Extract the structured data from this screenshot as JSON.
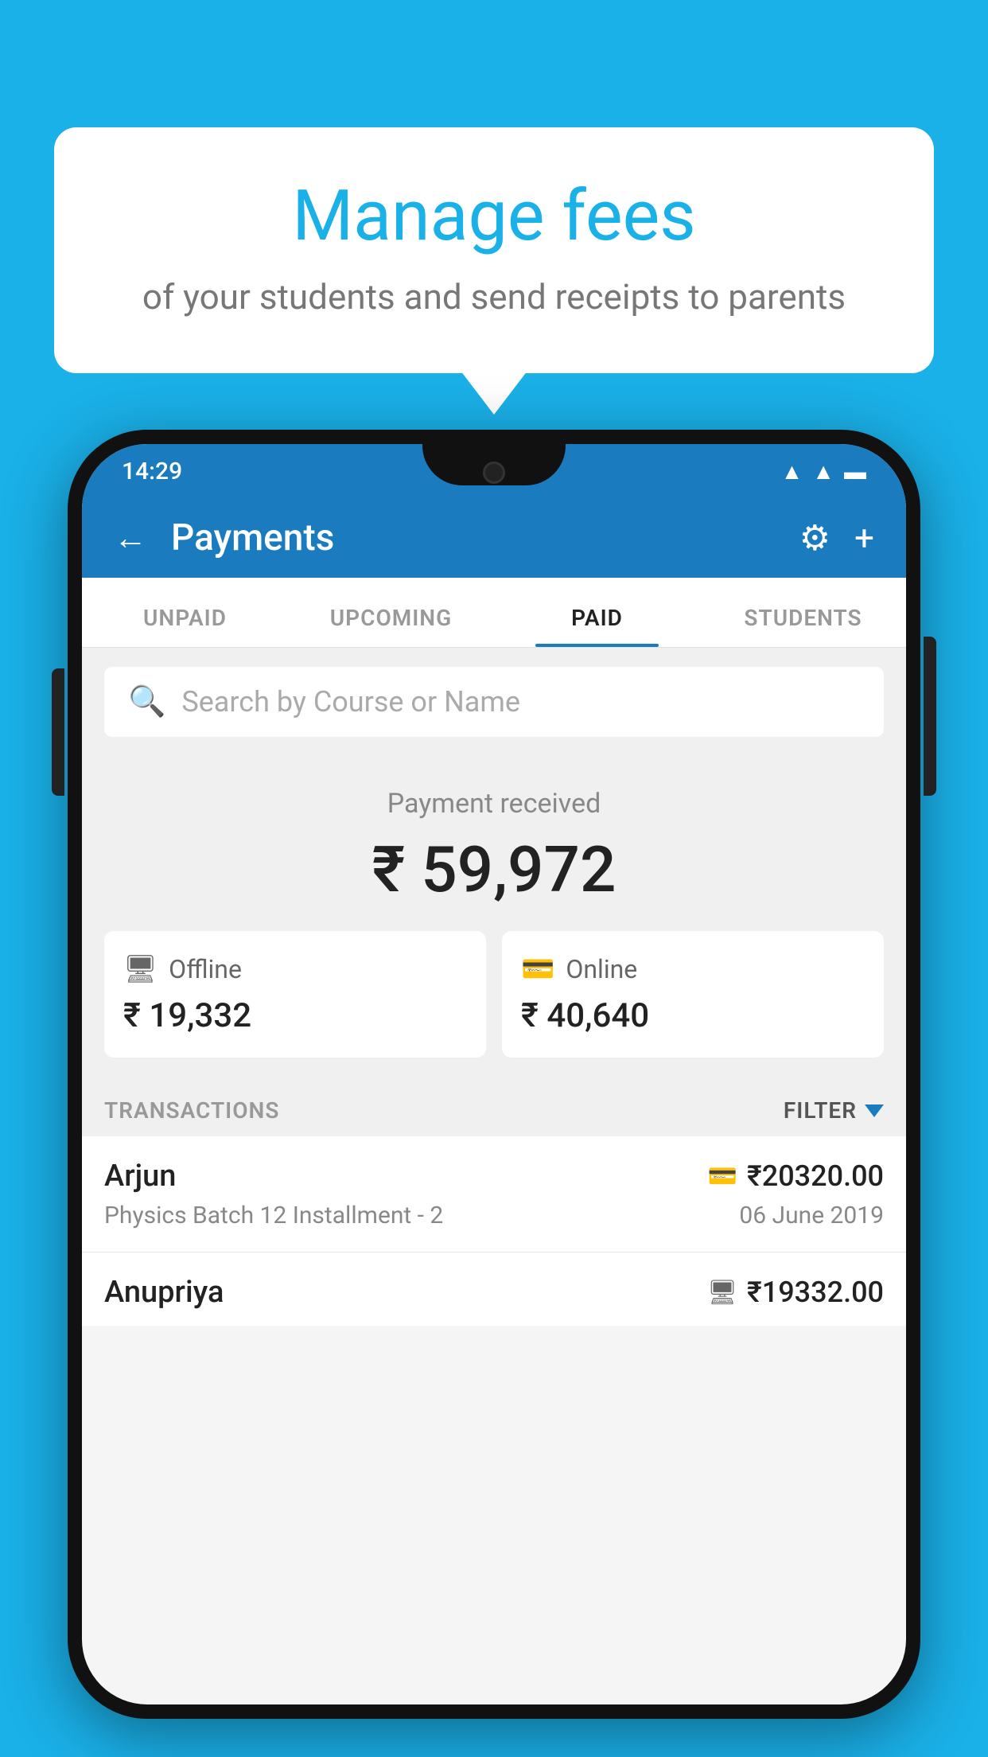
{
  "background_color": "#1ab0e8",
  "bubble": {
    "title": "Manage fees",
    "subtitle": "of your students and send receipts to parents"
  },
  "status_bar": {
    "time": "14:29",
    "wifi_icon": "▲",
    "signal_icon": "▲",
    "battery_icon": "▪"
  },
  "header": {
    "title": "Payments",
    "back_label": "←",
    "plus_label": "+"
  },
  "tabs": [
    {
      "label": "UNPAID",
      "active": false
    },
    {
      "label": "UPCOMING",
      "active": false
    },
    {
      "label": "PAID",
      "active": true
    },
    {
      "label": "STUDENTS",
      "active": false
    }
  ],
  "search": {
    "placeholder": "Search by Course or Name"
  },
  "payment_received": {
    "label": "Payment received",
    "amount": "₹ 59,972"
  },
  "cards": [
    {
      "type": "Offline",
      "amount": "₹ 19,332",
      "icon": "💳"
    },
    {
      "type": "Online",
      "amount": "₹ 40,640",
      "icon": "💳"
    }
  ],
  "transactions": {
    "label": "TRANSACTIONS",
    "filter_label": "FILTER"
  },
  "transaction_list": [
    {
      "name": "Arjun",
      "amount": "₹20320.00",
      "course": "Physics Batch 12 Installment - 2",
      "date": "06 June 2019",
      "payment_type": "online"
    },
    {
      "name": "Anupriya",
      "amount": "₹19332.00",
      "course": "",
      "date": "",
      "payment_type": "offline"
    }
  ]
}
